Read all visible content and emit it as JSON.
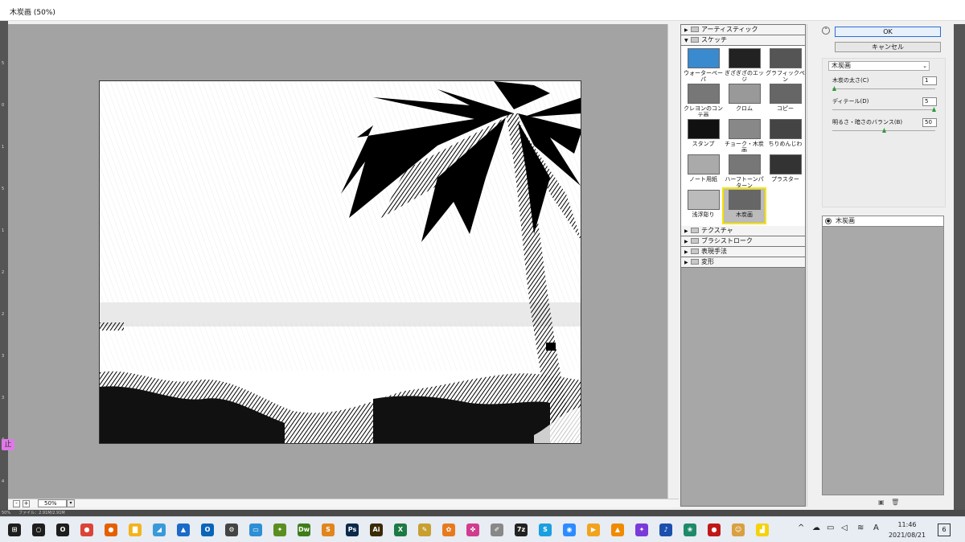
{
  "window": {
    "title": "木炭画 (50%)"
  },
  "ruler": {
    "marks": [
      "5",
      "0",
      "1",
      "5",
      "1",
      "2",
      "2",
      "3",
      "3",
      "4",
      "4"
    ]
  },
  "canvas": {
    "zoom_value": "50%",
    "zoom_minus": "-",
    "zoom_plus": "+",
    "zoom_dropdown": "▾"
  },
  "filters": {
    "categories_top": [
      {
        "label": "アーティスティック",
        "expanded": false
      }
    ],
    "sketch_category": {
      "label": "スケッチ",
      "expanded": true
    },
    "sketch_items": [
      {
        "label": "ウォーターペーパ",
        "selected": false
      },
      {
        "label": "ぎざぎざのエッジ",
        "selected": false
      },
      {
        "label": "グラフィックペン",
        "selected": false
      },
      {
        "label": "クレヨンのコンテ画",
        "selected": false
      },
      {
        "label": "クロム",
        "selected": false
      },
      {
        "label": "コピー",
        "selected": false
      },
      {
        "label": "スタンプ",
        "selected": false
      },
      {
        "label": "チョーク・木炭画",
        "selected": false
      },
      {
        "label": "ちりめんじわ",
        "selected": false
      },
      {
        "label": "ノート用紙",
        "selected": false
      },
      {
        "label": "ハーフトーンパターン",
        "selected": false
      },
      {
        "label": "プラスター",
        "selected": false
      },
      {
        "label": "浅浮彫り",
        "selected": false
      },
      {
        "label": "木炭画",
        "selected": true
      }
    ],
    "categories_bottom": [
      {
        "label": "テクスチャ"
      },
      {
        "label": "ブラシストローク"
      },
      {
        "label": "表現手法"
      },
      {
        "label": "変形"
      }
    ]
  },
  "dialog": {
    "ok_label": "OK",
    "cancel_label": "キャンセル",
    "filter_select": "木炭画",
    "params": [
      {
        "label": "木炭の太さ(C)",
        "value": "1",
        "fraction": 0.0
      },
      {
        "label": "ディテール(D)",
        "value": "5",
        "fraction": 1.0
      },
      {
        "label": "明るさ・暗さのバランス(B)",
        "value": "50",
        "fraction": 0.5
      }
    ],
    "layer_name": "木炭画"
  },
  "status": {
    "text": "50%　　ファイル：2.91M/2.91M"
  },
  "taskbar": {
    "clock_time": "11:46",
    "clock_date": "2021/08/21",
    "notification_count": "6",
    "ime_label": "A",
    "apps": [
      {
        "name": "start",
        "color": "#1e1e1e",
        "glyph": "⊞"
      },
      {
        "name": "search",
        "color": "#1e1e1e",
        "glyph": "○"
      },
      {
        "name": "cortana",
        "color": "#1e1e1e",
        "glyph": "O"
      },
      {
        "name": "chrome",
        "color": "#db4437",
        "glyph": "●"
      },
      {
        "name": "firefox",
        "color": "#e66000",
        "glyph": "●"
      },
      {
        "name": "explorer",
        "color": "#f2b31c",
        "glyph": "▇"
      },
      {
        "name": "tablet",
        "color": "#3a9ad9",
        "glyph": "◢"
      },
      {
        "name": "photos",
        "color": "#1b6ac9",
        "glyph": "▲"
      },
      {
        "name": "outlook",
        "color": "#0a64b8",
        "glyph": "O"
      },
      {
        "name": "settings",
        "color": "#444444",
        "glyph": "⚙"
      },
      {
        "name": "monitor",
        "color": "#2d8fd5",
        "glyph": "▭"
      },
      {
        "name": "visio",
        "color": "#5a8f1f",
        "glyph": "✦"
      },
      {
        "name": "dreamweaver",
        "color": "#3f7d1a",
        "glyph": "Dw"
      },
      {
        "name": "sublime",
        "color": "#e0861c",
        "glyph": "S"
      },
      {
        "name": "photoshop",
        "color": "#0a2a4a",
        "glyph": "Ps"
      },
      {
        "name": "illustrator",
        "color": "#3a2a06",
        "glyph": "Ai"
      },
      {
        "name": "excel",
        "color": "#1d7a43",
        "glyph": "X"
      },
      {
        "name": "pen",
        "color": "#c8a030",
        "glyph": "✎"
      },
      {
        "name": "butterfly",
        "color": "#e87a1e",
        "glyph": "✿"
      },
      {
        "name": "paint",
        "color": "#d03d8e",
        "glyph": "✤"
      },
      {
        "name": "brush",
        "color": "#888888",
        "glyph": "✐"
      },
      {
        "name": "7zip",
        "color": "#222222",
        "glyph": "7z"
      },
      {
        "name": "skype",
        "color": "#1a9fe0",
        "glyph": "S"
      },
      {
        "name": "zoom",
        "color": "#2d8cff",
        "glyph": "◉"
      },
      {
        "name": "media",
        "color": "#f2a31c",
        "glyph": "▶"
      },
      {
        "name": "vlc",
        "color": "#f08a00",
        "glyph": "▲"
      },
      {
        "name": "corgi",
        "color": "#7a3ad9",
        "glyph": "✦"
      },
      {
        "name": "music",
        "color": "#1b4fae",
        "glyph": "♪"
      },
      {
        "name": "tree",
        "color": "#1e8a6a",
        "glyph": "❀"
      },
      {
        "name": "record",
        "color": "#c01818",
        "glyph": "●"
      },
      {
        "name": "pet",
        "color": "#d8a040",
        "glyph": "☺"
      },
      {
        "name": "sticky",
        "color": "#f5d20a",
        "glyph": "▟"
      }
    ]
  }
}
